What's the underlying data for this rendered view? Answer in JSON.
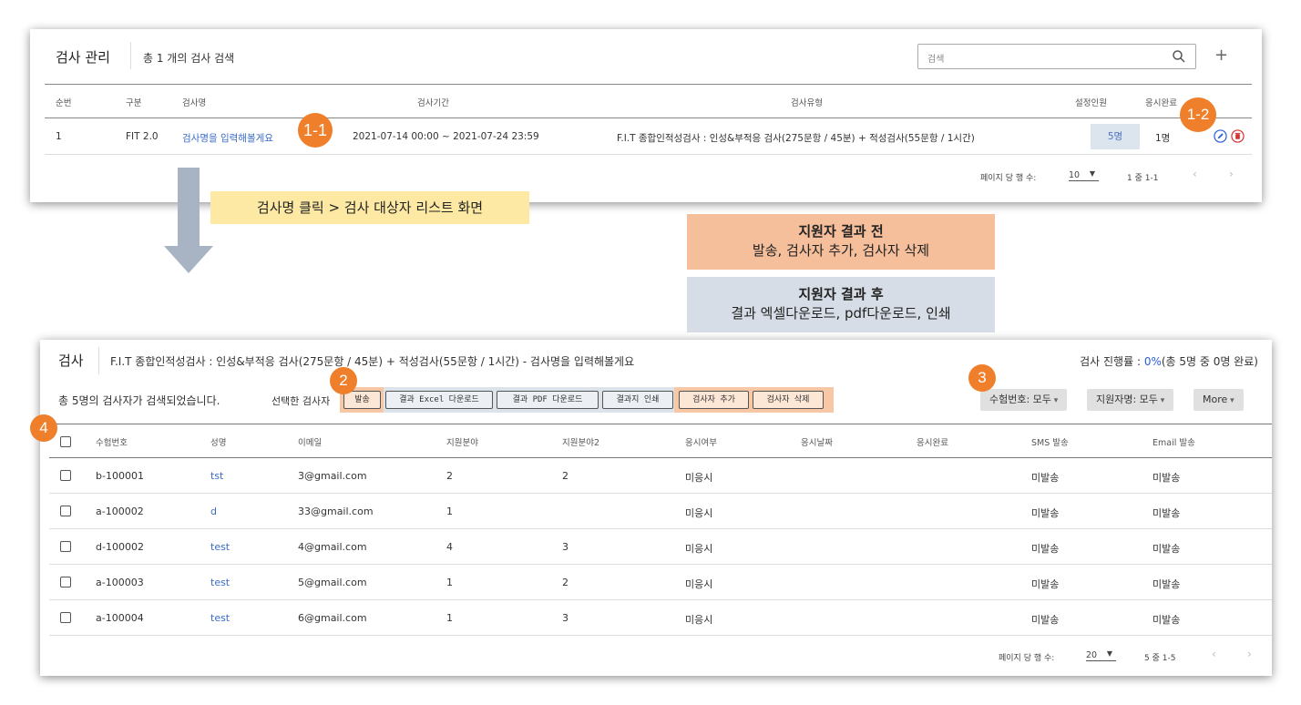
{
  "top": {
    "title": "검사 관리",
    "count_text": "총 1 개의 검사 검색",
    "search_placeholder": "검색",
    "add_label": "+",
    "columns": [
      "순번",
      "구분",
      "검사명",
      "검사기간",
      "검사유형",
      "설정인원",
      "응시완료"
    ],
    "row": {
      "no": "1",
      "type": "FIT 2.0",
      "name": "검사명을 입력해볼게요",
      "period": "2021-07-14 00:00 ~ 2021-07-24 23:59",
      "kind": "F.I.T 종합인적성검사 : 인성&부적응 검사(275문항 / 45분) + 적성검사(55문항 / 1시간)",
      "assigned": "5명",
      "completed": "1명"
    },
    "pager": {
      "label": "페이지 당 행 수:",
      "size": "10",
      "range": "1 중 1-1",
      "prev": "‹",
      "next": "›"
    }
  },
  "callouts": {
    "badge_1_1": "1-1",
    "badge_1_2": "1-2",
    "badge_2": "2",
    "badge_3": "3",
    "badge_4": "4",
    "nav_note": "검사명 클릭 > 검사 대상자 리스트 화면",
    "before_title": "지원자 결과 전",
    "before_sub": "발송, 검사자 추가, 검사자 삭제",
    "after_title": "지원자 결과 후",
    "after_sub": "결과 엑셀다운로드, pdf다운로드, 인쇄"
  },
  "bottom": {
    "title": "검사",
    "subtitle": "F.I.T 종합인적성검사 : 인성&부적응 검사(275문항 / 45분) + 적성검사(55문항 / 1시간) - 검사명을 입력해볼게요",
    "progress_label": "검사 진행률 : ",
    "progress_pct": "0%",
    "progress_detail": "(총 5명 중 0명 완료)",
    "result_text": "총 5명의 검사자가 검색되었습니다.",
    "selected_label": "선택한 검사자",
    "buttons": {
      "send": "발송",
      "excel": "결과 Excel 다운로드",
      "pdf": "결과 PDF 다운로드",
      "print": "결과지 인쇄",
      "add": "검사자 추가",
      "delete": "검사자 삭제"
    },
    "filters": {
      "exam_no": "수험번호: 모두",
      "applicant": "지원자명: 모두",
      "more": "More"
    },
    "columns": [
      "수험번호",
      "성명",
      "이메일",
      "지원분야",
      "지원분야2",
      "응시여부",
      "응시날짜",
      "응시완료",
      "SMS 발송",
      "Email 발송"
    ],
    "rows": [
      {
        "id": "b-100001",
        "name": "tst",
        "email": "3@gmail.com",
        "field1": "2",
        "field2": "2",
        "status": "미응시",
        "sms": "미발송",
        "mail": "미발송"
      },
      {
        "id": "a-100002",
        "name": "d",
        "email": "33@gmail.com",
        "field1": "1",
        "field2": "",
        "status": "미응시",
        "sms": "미발송",
        "mail": "미발송"
      },
      {
        "id": "d-100002",
        "name": "test",
        "email": "4@gmail.com",
        "field1": "4",
        "field2": "3",
        "status": "미응시",
        "sms": "미발송",
        "mail": "미발송"
      },
      {
        "id": "a-100003",
        "name": "test",
        "email": "5@gmail.com",
        "field1": "1",
        "field2": "2",
        "status": "미응시",
        "sms": "미발송",
        "mail": "미발송"
      },
      {
        "id": "a-100004",
        "name": "test",
        "email": "6@gmail.com",
        "field1": "1",
        "field2": "3",
        "status": "미응시",
        "sms": "미발송",
        "mail": "미발송"
      }
    ],
    "pager": {
      "label": "페이지 당 행 수:",
      "size": "20",
      "range": "5 중 1-5",
      "prev": "‹",
      "next": "›"
    }
  },
  "colors": {
    "accent_badge": "#ef7f2a",
    "link": "#3b6cc8",
    "progress": "#2a5cd9"
  },
  "icons": [
    "search-icon",
    "plus-icon",
    "edit-icon",
    "delete-icon",
    "down-arrow-icon",
    "dropdown-caret-icon",
    "checkbox-icon"
  ]
}
